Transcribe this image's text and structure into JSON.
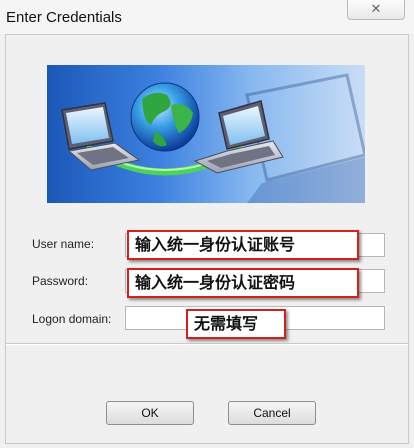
{
  "window": {
    "title": "Enter Credentials",
    "close_label": "✕"
  },
  "banner": {
    "icon": "network-globe-laptops-image"
  },
  "form": {
    "user_name_label": "User name:",
    "password_label": "Password:",
    "logon_domain_label": "Logon domain:",
    "user_name_value": "",
    "password_value": "",
    "logon_domain_value": ""
  },
  "annotations": {
    "user_name_note": "输入统一身份认证账号",
    "password_note": "输入统一身份认证密码",
    "domain_note": "无需填写",
    "border_color": "#d21f1f"
  },
  "buttons": {
    "ok_label": "OK",
    "cancel_label": "Cancel"
  }
}
